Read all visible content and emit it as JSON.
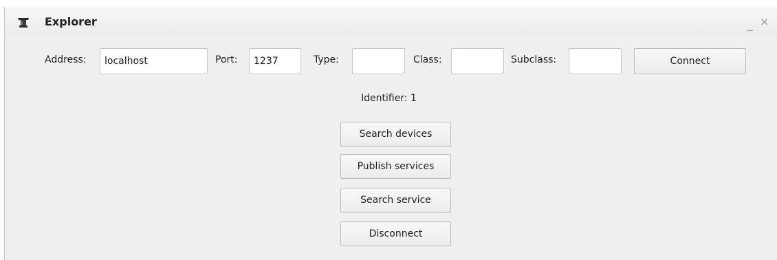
{
  "window": {
    "title": "Explorer",
    "minimize_glyph": "_",
    "close_glyph": "×"
  },
  "connection": {
    "address_label": "Address:",
    "address_value": "localhost",
    "port_label": "Port:",
    "port_value": "1237",
    "type_label": "Type:",
    "type_value": "",
    "class_label": "Class:",
    "class_value": "",
    "subclass_label": "Subclass:",
    "subclass_value": "",
    "connect_label": "Connect"
  },
  "identifier_text": "Identifier: 1",
  "actions": {
    "search_devices": "Search devices",
    "publish_services": "Publish services",
    "search_service": "Search service",
    "disconnect": "Disconnect"
  },
  "icons": {
    "app": "app-hat-icon",
    "minimize": "minimize-icon",
    "close": "close-icon"
  }
}
